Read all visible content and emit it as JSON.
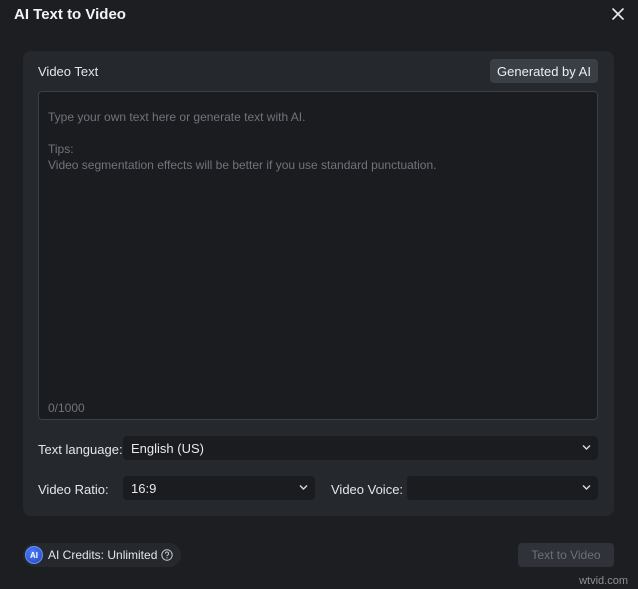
{
  "window": {
    "title": "AI Text to Video"
  },
  "video_text": {
    "label": "Video Text",
    "generate_button": "Generated by AI",
    "placeholder": "Type your own text here or generate text with AI.",
    "tips_title": "Tips:",
    "tips_text": "Video segmentation effects will be better if you use standard punctuation.",
    "counter": "0/1000"
  },
  "text_language": {
    "label": "Text language:",
    "value": "English (US)"
  },
  "video_ratio": {
    "label": "Video Ratio:",
    "value": "16:9"
  },
  "video_voice": {
    "label": "Video Voice:",
    "value": ""
  },
  "footer": {
    "ai_badge": "AI",
    "credits": "AI Credits: Unlimited",
    "text_to_video_button": "Text to Video"
  },
  "watermark": "wtvid.com",
  "icons": {
    "close": "close-icon",
    "chevron": "chevron-down-icon",
    "help": "help-icon"
  }
}
